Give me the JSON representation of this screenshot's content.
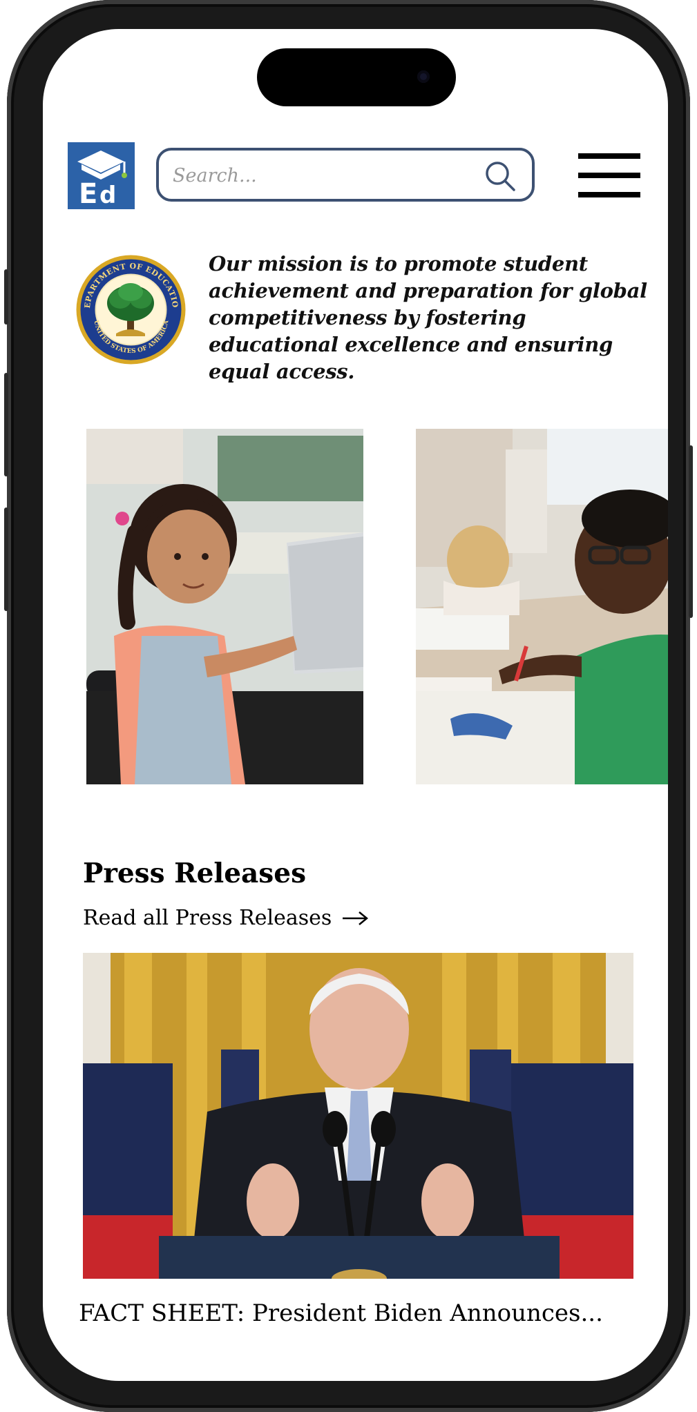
{
  "header": {
    "logo_label": "Ed",
    "search_placeholder": "Search...",
    "menu_icon": "hamburger-menu-icon"
  },
  "mission": {
    "seal_top_text": "DEPARTMENT OF EDUCATION",
    "seal_bottom_text": "UNITED STATES OF AMERICA",
    "text": "Our mission is to promote student achievement and preparation for global competitiveness by fostering educational excellence and ensuring equal access."
  },
  "carousel": {
    "images": [
      {
        "alt": "Girl in wheelchair using a laptop in a classroom"
      },
      {
        "alt": "Students drawing at a classroom table"
      }
    ]
  },
  "press": {
    "title": "Press Releases",
    "link_label": "Read all Press Releases",
    "link_icon": "arrow-right-icon",
    "items": [
      {
        "headline": "FACT SHEET: President Biden Announces...",
        "image_alt": "Speaker at podium in front of flags"
      }
    ]
  },
  "colors": {
    "logo_blue": "#2c62a8",
    "search_border": "#3d5172",
    "seal_gold": "#d9a825",
    "seal_blue": "#1d3d8f"
  }
}
